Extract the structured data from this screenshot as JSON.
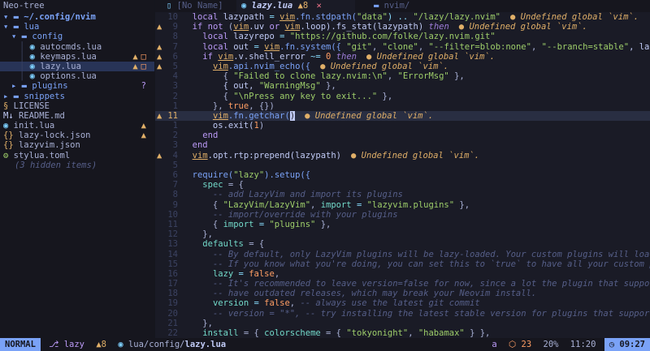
{
  "sidebar": {
    "title": "Neo-tree",
    "root": "~/.config/nvim",
    "items": [
      {
        "name": "lua",
        "kind": "dir",
        "open": true,
        "depth": 0
      },
      {
        "name": "config",
        "kind": "dir",
        "open": true,
        "depth": 1
      },
      {
        "name": "autocmds.lua",
        "kind": "lua",
        "depth": 2
      },
      {
        "name": "keymaps.lua",
        "kind": "lua",
        "depth": 2,
        "warn": true,
        "mod": true
      },
      {
        "name": "lazy.lua",
        "kind": "lua",
        "depth": 2,
        "warn": true,
        "mod": true,
        "selected": true
      },
      {
        "name": "options.lua",
        "kind": "lua",
        "depth": 2
      },
      {
        "name": "plugins",
        "kind": "dir",
        "open": false,
        "depth": 1,
        "untracked": true
      },
      {
        "name": "snippets",
        "kind": "dir",
        "open": false,
        "depth": 0
      },
      {
        "name": "LICENSE",
        "kind": "lic",
        "depth": 0
      },
      {
        "name": "README.md",
        "kind": "md",
        "depth": 0
      },
      {
        "name": "init.lua",
        "kind": "lua",
        "depth": 0,
        "warn": true
      },
      {
        "name": "lazy-lock.json",
        "kind": "json",
        "depth": 0,
        "warn": true
      },
      {
        "name": "lazyvim.json",
        "kind": "json",
        "depth": 0
      },
      {
        "name": "stylua.toml",
        "kind": "toml",
        "depth": 0
      }
    ],
    "hidden_note": "(3 hidden items)",
    "warn_glyph": "▲",
    "mod_glyph": "□",
    "untracked_glyph": "?"
  },
  "tabs": [
    {
      "label": "[No Name]",
      "active": false
    },
    {
      "label": "lazy.lua",
      "active": true,
      "count": "8"
    },
    {
      "label": "nvim/",
      "active": false
    }
  ],
  "editor": {
    "diag_text": "Undefined global `vim`.",
    "lines": [
      {
        "n": "10",
        "sign": "",
        "segs": [
          [
            "  ",
            "var"
          ],
          [
            "local ",
            "kw"
          ],
          [
            "lazypath",
            "var"
          ],
          [
            " = ",
            "op"
          ],
          [
            "vim",
            "vim"
          ],
          [
            ".fn.stdpath(",
            "fn"
          ],
          [
            "\"data\"",
            "str"
          ],
          [
            ") .. ",
            "op"
          ],
          [
            "\"/lazy/lazy.nvim\"",
            "str"
          ]
        ],
        "diag": true
      },
      {
        "n": "9",
        "sign": "▲",
        "segs": [
          [
            "  ",
            "var"
          ],
          [
            "if not ",
            "kw"
          ],
          [
            "(",
            "punc"
          ],
          [
            "vim",
            "vim"
          ],
          [
            ".uv ",
            "var"
          ],
          [
            "or ",
            "kw"
          ],
          [
            "vim",
            "vim"
          ],
          [
            ".loop).fs_stat(lazypath) ",
            "var"
          ],
          [
            "then",
            "kw-i"
          ]
        ],
        "diag": true
      },
      {
        "n": "8",
        "sign": "",
        "segs": [
          [
            "    ",
            "var"
          ],
          [
            "local ",
            "kw"
          ],
          [
            "lazyrepo",
            "var"
          ],
          [
            " = ",
            "op"
          ],
          [
            "\"https://github.com/folke/lazy.nvim.git\"",
            "str"
          ]
        ]
      },
      {
        "n": "7",
        "sign": "▲",
        "segs": [
          [
            "    ",
            "var"
          ],
          [
            "local ",
            "kw"
          ],
          [
            "out",
            "var"
          ],
          [
            " = ",
            "op"
          ],
          [
            "vim",
            "vim"
          ],
          [
            ".fn.system({ ",
            "fn"
          ],
          [
            "\"git\"",
            "str"
          ],
          [
            ", ",
            "punc"
          ],
          [
            "\"clone\"",
            "str"
          ],
          [
            ", ",
            "punc"
          ],
          [
            "\"--filter=blob:none\"",
            "str"
          ],
          [
            ", ",
            "punc"
          ],
          [
            "\"--branch=stable\"",
            "str"
          ],
          [
            ", lazyrepo, lazypath })",
            "var"
          ]
        ]
      },
      {
        "n": "6",
        "sign": "▲",
        "segs": [
          [
            "    ",
            "var"
          ],
          [
            "if ",
            "kw"
          ],
          [
            "vim",
            "vim"
          ],
          [
            ".v.shell_error ",
            "var"
          ],
          [
            "~= ",
            "op"
          ],
          [
            "0 ",
            "num"
          ],
          [
            "then",
            "kw-i"
          ]
        ],
        "diag": true
      },
      {
        "n": "5",
        "sign": "▲",
        "segs": [
          [
            "      ",
            "var"
          ],
          [
            "vim",
            "vim"
          ],
          [
            ".api.nvim_echo({",
            "fn"
          ]
        ],
        "diag": true
      },
      {
        "n": "4",
        "sign": "",
        "segs": [
          [
            "        { ",
            "punc"
          ],
          [
            "\"Failed to clone lazy.nvim:\\n\"",
            "str"
          ],
          [
            ", ",
            "punc"
          ],
          [
            "\"ErrorMsg\"",
            "str"
          ],
          [
            " },",
            "punc"
          ]
        ]
      },
      {
        "n": "3",
        "sign": "",
        "segs": [
          [
            "        { out, ",
            "var"
          ],
          [
            "\"WarningMsg\"",
            "str"
          ],
          [
            " },",
            "punc"
          ]
        ]
      },
      {
        "n": "2",
        "sign": "",
        "segs": [
          [
            "        { ",
            "punc"
          ],
          [
            "\"\\nPress any key to exit...\"",
            "str"
          ],
          [
            " },",
            "punc"
          ]
        ]
      },
      {
        "n": "1",
        "sign": "",
        "segs": [
          [
            "      }, ",
            "punc"
          ],
          [
            "true",
            "const"
          ],
          [
            ", {})",
            "punc"
          ]
        ]
      },
      {
        "n": "11",
        "sign": "▲",
        "cur": true,
        "segs": [
          [
            "      ",
            "var"
          ],
          [
            "vim",
            "vim"
          ],
          [
            ".fn.getchar(",
            "fn"
          ],
          [
            ")",
            "cursor"
          ]
        ],
        "diag": true
      },
      {
        "n": "1",
        "sign": "",
        "segs": [
          [
            "      os.exit(",
            "var"
          ],
          [
            "1",
            "num"
          ],
          [
            ")",
            "punc"
          ]
        ]
      },
      {
        "n": "2",
        "sign": "",
        "segs": [
          [
            "    ",
            "var"
          ],
          [
            "end",
            "kw"
          ]
        ]
      },
      {
        "n": "3",
        "sign": "",
        "segs": [
          [
            "  ",
            "var"
          ],
          [
            "end",
            "kw"
          ]
        ]
      },
      {
        "n": "4",
        "sign": "▲",
        "segs": [
          [
            "  ",
            "var"
          ],
          [
            "vim",
            "vim"
          ],
          [
            ".opt.rtp:prepend(lazypath)",
            "var"
          ]
        ],
        "diag": true
      },
      {
        "n": "5",
        "sign": "",
        "segs": []
      },
      {
        "n": "6",
        "sign": "",
        "segs": [
          [
            "  ",
            "var"
          ],
          [
            "require(",
            "fn"
          ],
          [
            "\"lazy\"",
            "str"
          ],
          [
            ").setup({",
            "fn"
          ]
        ]
      },
      {
        "n": "7",
        "sign": "",
        "segs": [
          [
            "    ",
            "var"
          ],
          [
            "spec",
            "prop"
          ],
          [
            " = {",
            "punc"
          ]
        ]
      },
      {
        "n": "8",
        "sign": "",
        "segs": [
          [
            "      ",
            "var"
          ],
          [
            "-- add LazyVim and import its plugins",
            "cmt"
          ]
        ]
      },
      {
        "n": "9",
        "sign": "",
        "segs": [
          [
            "      { ",
            "punc"
          ],
          [
            "\"LazyVim/LazyVim\"",
            "str"
          ],
          [
            ", ",
            "punc"
          ],
          [
            "import",
            "prop"
          ],
          [
            " = ",
            "op"
          ],
          [
            "\"lazyvim.plugins\"",
            "str"
          ],
          [
            " },",
            "punc"
          ]
        ]
      },
      {
        "n": "10",
        "sign": "",
        "segs": [
          [
            "      ",
            "var"
          ],
          [
            "-- import/override with your plugins",
            "cmt"
          ]
        ]
      },
      {
        "n": "11",
        "sign": "",
        "segs": [
          [
            "      { ",
            "punc"
          ],
          [
            "import",
            "prop"
          ],
          [
            " = ",
            "op"
          ],
          [
            "\"plugins\"",
            "str"
          ],
          [
            " },",
            "punc"
          ]
        ]
      },
      {
        "n": "12",
        "sign": "",
        "segs": [
          [
            "    },",
            "punc"
          ]
        ]
      },
      {
        "n": "13",
        "sign": "",
        "segs": [
          [
            "    ",
            "var"
          ],
          [
            "defaults",
            "prop"
          ],
          [
            " = {",
            "punc"
          ]
        ]
      },
      {
        "n": "14",
        "sign": "",
        "segs": [
          [
            "      ",
            "var"
          ],
          [
            "-- By default, only LazyVim plugins will be lazy-loaded. Your custom plugins will load during startup.",
            "cmt"
          ]
        ]
      },
      {
        "n": "15",
        "sign": "",
        "segs": [
          [
            "      ",
            "var"
          ],
          [
            "-- If you know what you're doing, you can set this to `true` to have all your custom plugins lazy-loaded",
            "cmt"
          ]
        ]
      },
      {
        "n": "16",
        "sign": "",
        "segs": [
          [
            "      ",
            "var"
          ],
          [
            "lazy",
            "prop"
          ],
          [
            " = ",
            "op"
          ],
          [
            "false",
            "const"
          ],
          [
            ",",
            "punc"
          ]
        ]
      },
      {
        "n": "17",
        "sign": "",
        "segs": [
          [
            "      ",
            "var"
          ],
          [
            "-- It's recommended to leave version=false for now, since a lot the plugin that support versioning,",
            "cmt"
          ]
        ]
      },
      {
        "n": "18",
        "sign": "",
        "segs": [
          [
            "      ",
            "var"
          ],
          [
            "-- have outdated releases, which may break your Neovim install.",
            "cmt"
          ]
        ]
      },
      {
        "n": "19",
        "sign": "",
        "segs": [
          [
            "      ",
            "var"
          ],
          [
            "version",
            "prop"
          ],
          [
            " = ",
            "op"
          ],
          [
            "false",
            "const"
          ],
          [
            ", ",
            "punc"
          ],
          [
            "-- always use the latest git commit",
            "cmt"
          ]
        ]
      },
      {
        "n": "20",
        "sign": "",
        "segs": [
          [
            "      ",
            "var"
          ],
          [
            "-- version = \"*\", -- try installing the latest stable version for plugins that support semver",
            "cmt"
          ]
        ]
      },
      {
        "n": "21",
        "sign": "",
        "segs": [
          [
            "    },",
            "punc"
          ]
        ]
      },
      {
        "n": "22",
        "sign": "",
        "segs": [
          [
            "    ",
            "var"
          ],
          [
            "install",
            "prop"
          ],
          [
            " = { ",
            "punc"
          ],
          [
            "colorscheme",
            "prop"
          ],
          [
            " = { ",
            "punc"
          ],
          [
            "\"tokyonight\"",
            "str"
          ],
          [
            ", ",
            "punc"
          ],
          [
            "\"habamax\"",
            "str"
          ],
          [
            " } },",
            "punc"
          ]
        ]
      }
    ]
  },
  "status": {
    "mode": "NORMAL",
    "branch": "lazy",
    "warnings": "8",
    "path_dir": "lua/config/",
    "path_file": "lazy.lua",
    "right_a": "a",
    "plugins": "23",
    "percent": "20%",
    "pos": "11:20",
    "clock": "09:27"
  }
}
